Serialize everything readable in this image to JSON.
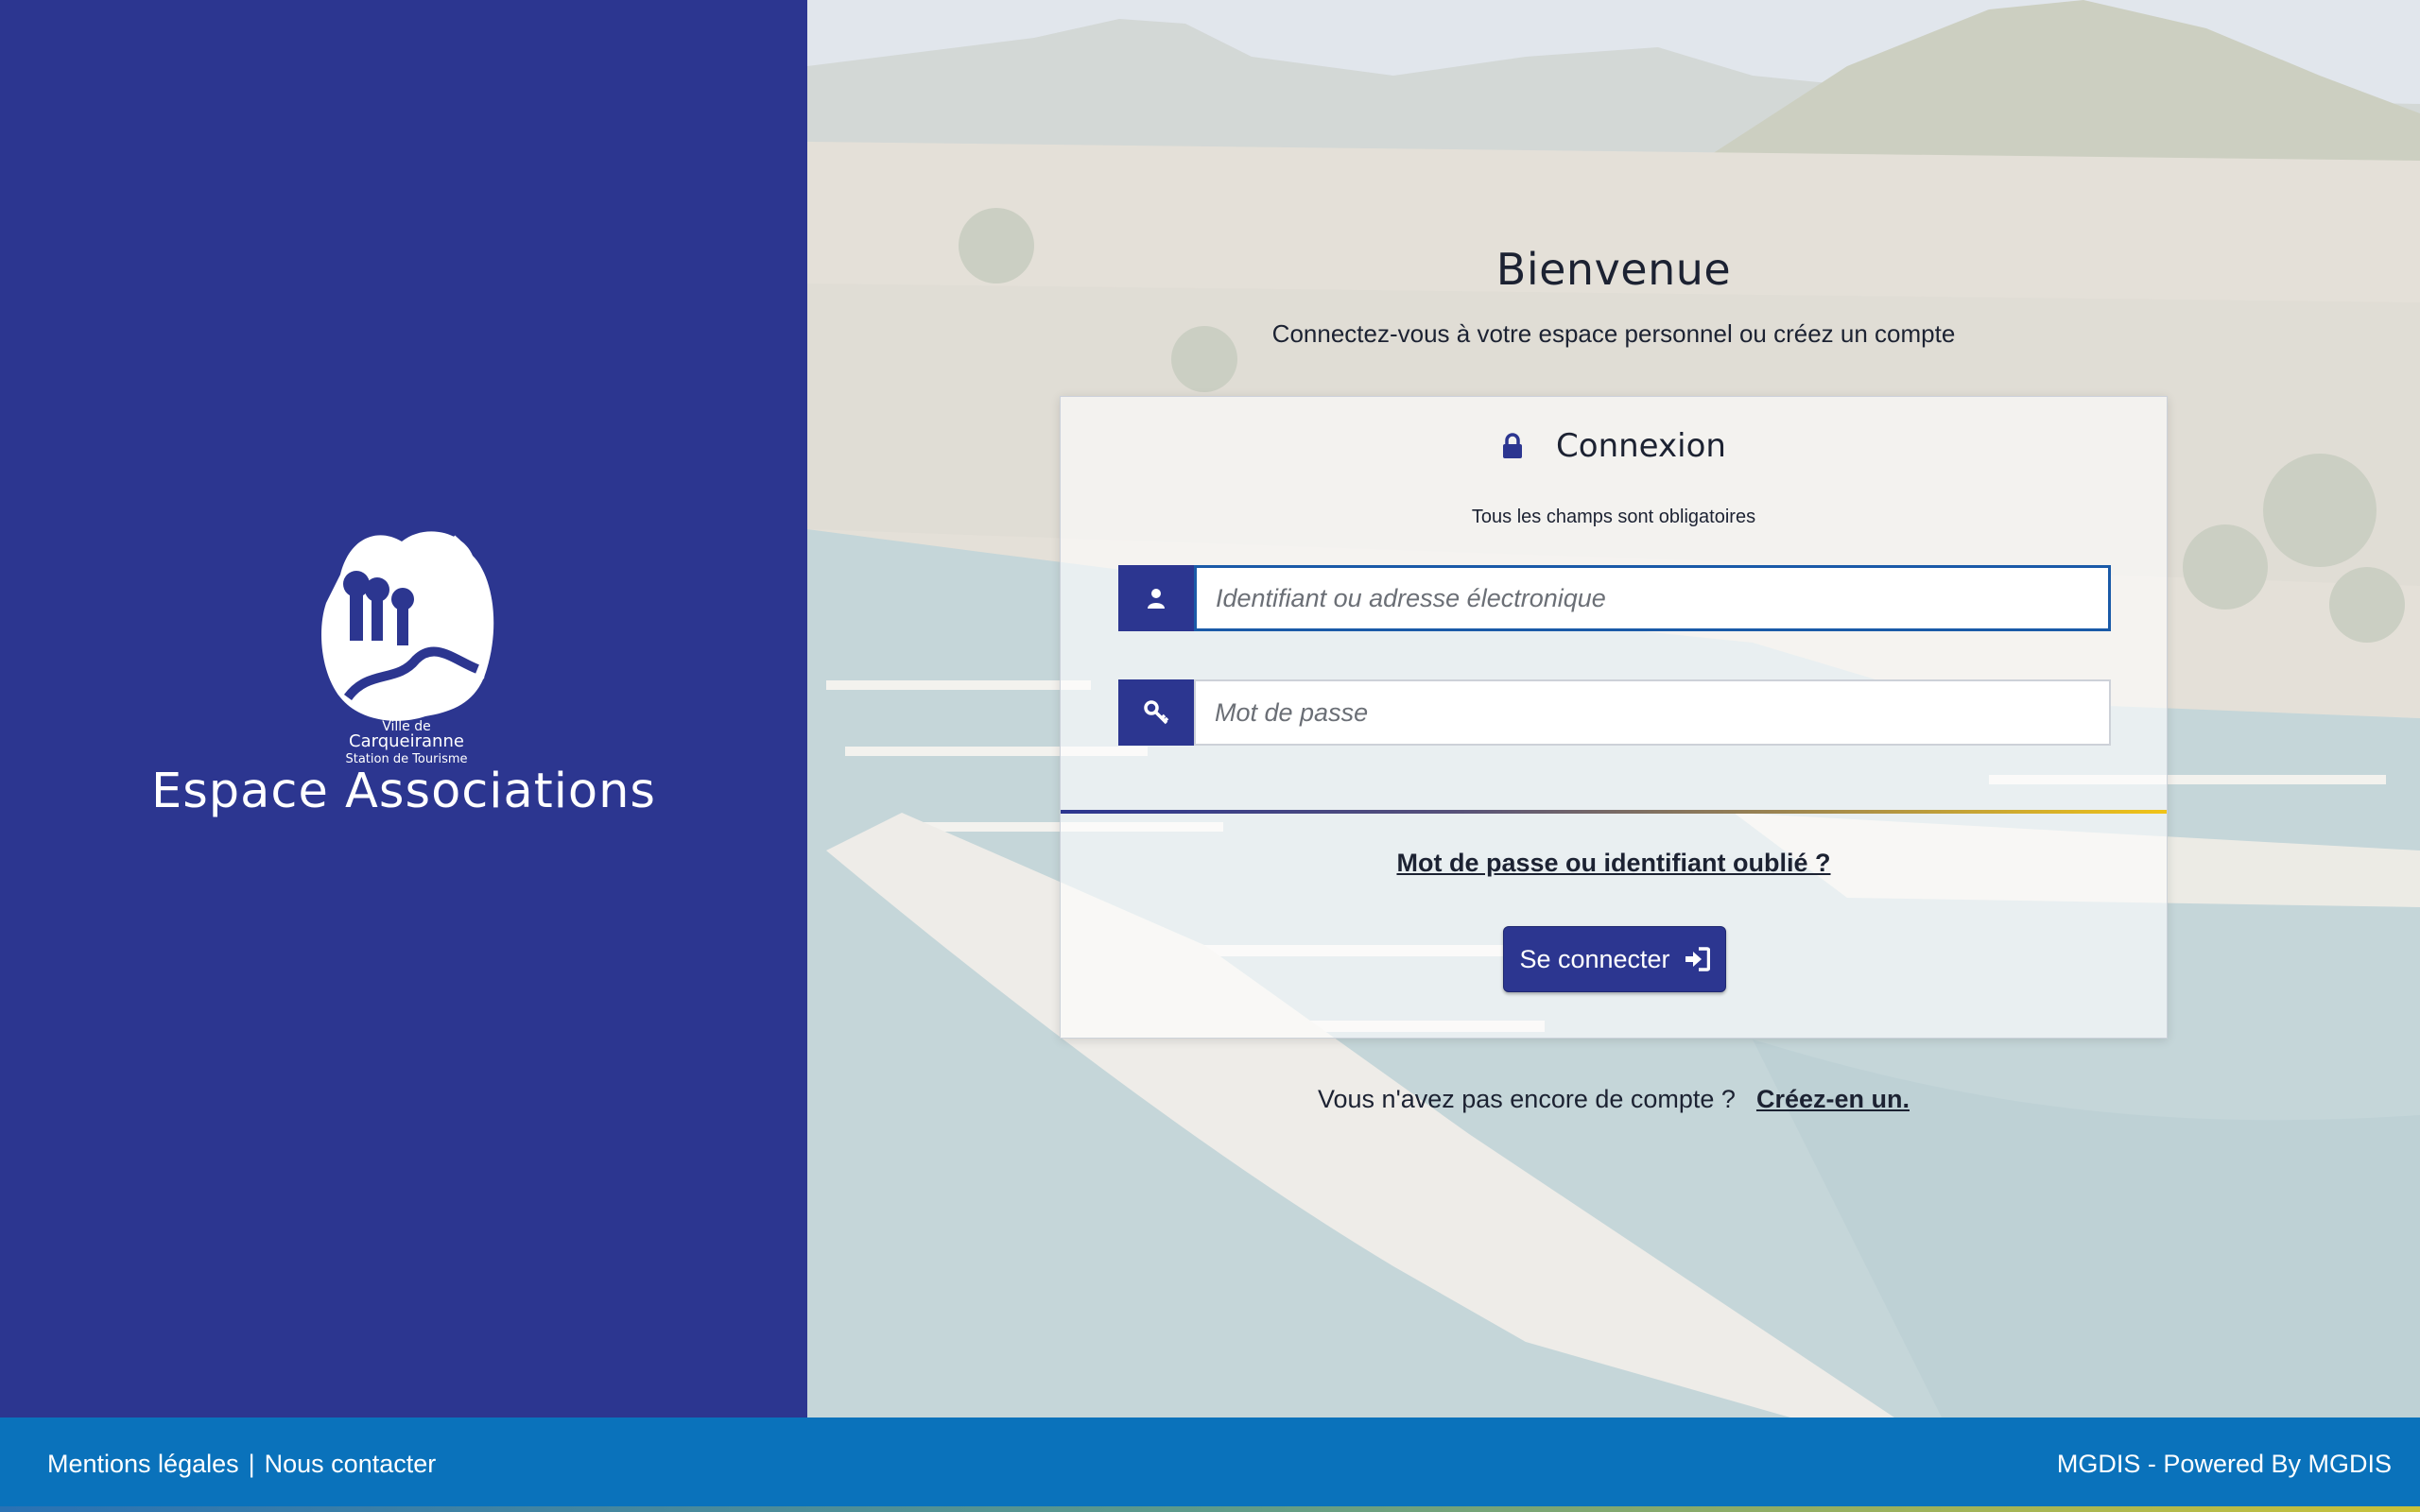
{
  "brand": {
    "title": "Espace Associations",
    "logo_icon": "carqueiranne-logo",
    "logo_text_line1": "Ville de",
    "logo_text_line2": "Carqueiranne",
    "logo_text_line3": "Station de Tourisme"
  },
  "welcome": {
    "title": "Bienvenue",
    "subtitle": "Connectez-vous à votre espace personnel ou créez un compte"
  },
  "login": {
    "title": "Connexion",
    "title_icon": "lock-icon",
    "required_note": "Tous les champs sont obligatoires",
    "username_placeholder": "Identifiant ou adresse électronique",
    "username_icon": "user-icon",
    "password_placeholder": "Mot de passe",
    "password_icon": "key-icon",
    "forgot_label": "Mot de passe ou identifiant oublié ?",
    "submit_label": "Se connecter",
    "submit_icon": "sign-in-icon"
  },
  "signup": {
    "prompt": "Vous n'avez pas encore de compte ?",
    "link_label": "Créez-en un."
  },
  "footer": {
    "legal": "Mentions légales",
    "separator": "|",
    "contact": "Nous contacter",
    "credit": "MGDIS - Powered By MGDIS"
  },
  "colors": {
    "primary": "#2c3690",
    "footer": "#0a72bb",
    "accent_gold": "#f1c418"
  }
}
